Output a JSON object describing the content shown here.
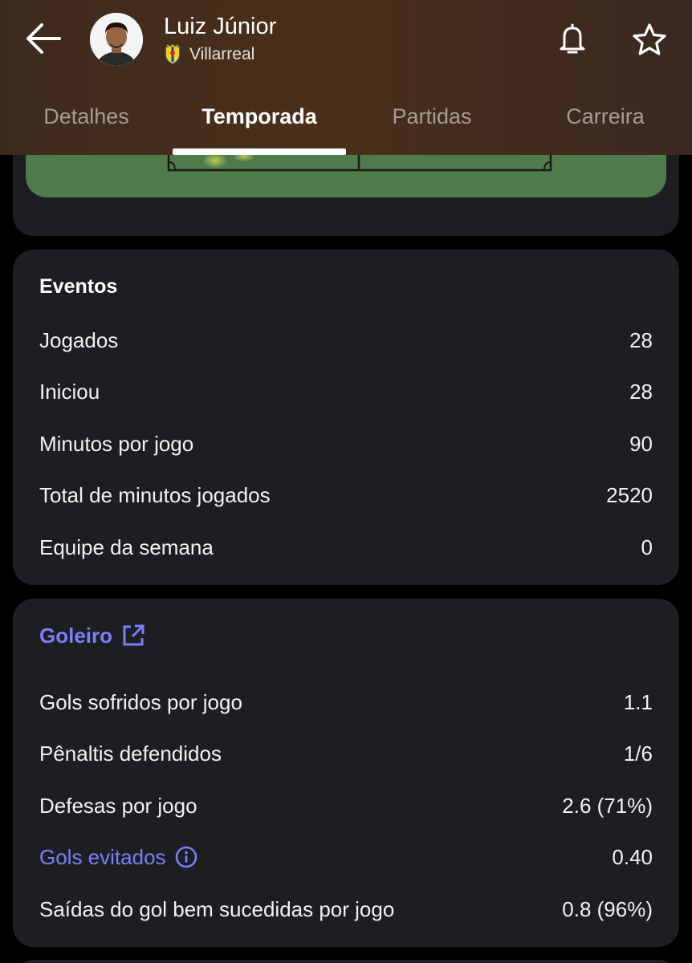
{
  "header": {
    "player_name": "Luiz Júnior",
    "club_name": "Villarreal",
    "back_icon": "arrow-left-icon",
    "bell_icon": "bell-icon",
    "star_icon": "star-icon"
  },
  "tabs": [
    {
      "label": "Detalhes"
    },
    {
      "label": "Temporada"
    },
    {
      "label": "Partidas"
    },
    {
      "label": "Carreira"
    }
  ],
  "active_tab": "Temporada",
  "eventos": {
    "title": "Eventos",
    "rows": [
      {
        "label": "Jogados",
        "value": "28"
      },
      {
        "label": "Iniciou",
        "value": "28"
      },
      {
        "label": "Minutos por jogo",
        "value": "90"
      },
      {
        "label": "Total de minutos jogados",
        "value": "2520"
      },
      {
        "label": "Equipe da semana",
        "value": "0"
      }
    ]
  },
  "goleiro": {
    "title": "Goleiro",
    "title_icon": "external-link-icon",
    "rows": [
      {
        "label": "Gols sofridos por jogo",
        "value": "1.1"
      },
      {
        "label": "Pênaltis defendidos",
        "value": "1/6"
      },
      {
        "label": "Defesas por jogo",
        "value": "2.6 (71%)"
      },
      {
        "label": "Gols evitados",
        "value": "0.40",
        "icon": "info-icon"
      },
      {
        "label": "Saídas do gol bem sucedidas por jogo",
        "value": "0.8 (96%)"
      }
    ]
  },
  "colors": {
    "accent": "#7b7ef5",
    "card_bg": "#1c1e22",
    "pitch": "#4e7a4c"
  }
}
